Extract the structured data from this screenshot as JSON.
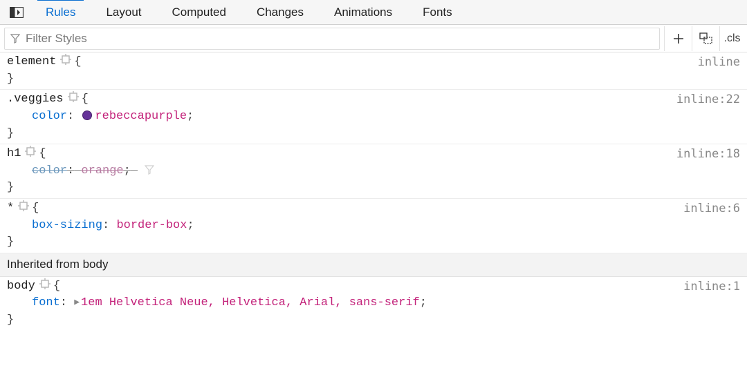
{
  "tabs": {
    "items": [
      {
        "label": "Rules",
        "active": true
      },
      {
        "label": "Layout",
        "active": false
      },
      {
        "label": "Computed",
        "active": false
      },
      {
        "label": "Changes",
        "active": false
      },
      {
        "label": "Animations",
        "active": false
      },
      {
        "label": "Fonts",
        "active": false
      }
    ]
  },
  "filter": {
    "placeholder": "Filter Styles",
    "cls_label": ".cls"
  },
  "inherited_header": "Inherited from body",
  "rules": [
    {
      "selector": "element",
      "source": "inline",
      "declarations": []
    },
    {
      "selector": ".veggies",
      "source": "inline:22",
      "declarations": [
        {
          "property": "color",
          "value": "rebeccapurple",
          "swatch": "#663399",
          "overridden": false
        }
      ]
    },
    {
      "selector": "h1",
      "source": "inline:18",
      "declarations": [
        {
          "property": "color",
          "value": "orange",
          "overridden": true,
          "filterable": true
        }
      ]
    },
    {
      "selector": "*",
      "source": "inline:6",
      "declarations": [
        {
          "property": "box-sizing",
          "value": "border-box",
          "overridden": false
        }
      ]
    }
  ],
  "inherited_rules": [
    {
      "selector": "body",
      "source": "inline:1",
      "declarations": [
        {
          "property": "font",
          "value": "1em Helvetica Neue, Helvetica, Arial, sans-serif",
          "expandable": true,
          "overridden": false
        }
      ]
    }
  ]
}
